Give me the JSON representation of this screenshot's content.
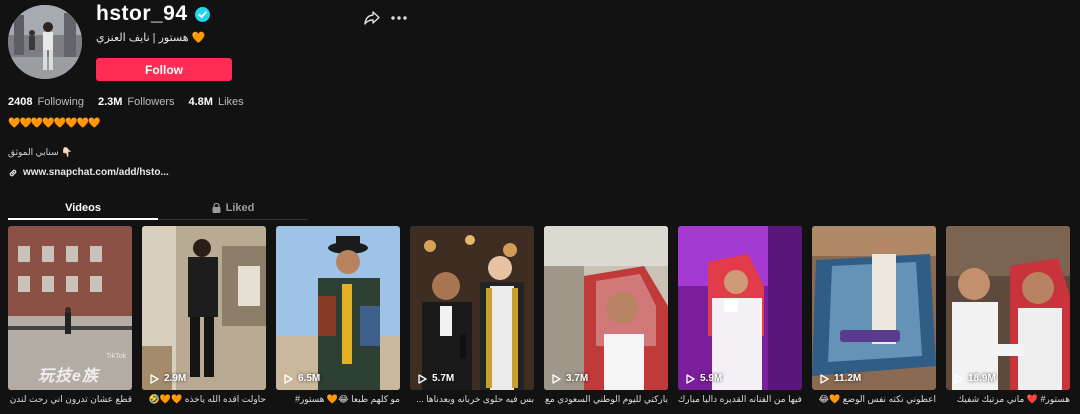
{
  "profile": {
    "username": "hstor_94",
    "nickname": "هستور | نايف العنزي 🧡",
    "follow_label": "Follow"
  },
  "stats": {
    "following_count": "2408",
    "following_label": "Following",
    "followers_count": "2.3M",
    "followers_label": "Followers",
    "likes_count": "4.8M",
    "likes_label": "Likes"
  },
  "bio": {
    "hearts": "🧡🧡🧡🧡🧡🧡🧡🧡",
    "line": "سنابي الموثق 👇🏻",
    "link": "www.snapchat.com/add/hsto..."
  },
  "tabs": {
    "videos": "Videos",
    "liked": "Liked"
  },
  "videos": [
    {
      "views": "",
      "caption": "قطع عشان تدرون اني رحت لندن"
    },
    {
      "views": "2.9M",
      "caption": "حاولت اقده الله ياخذه 🧡🧡🤣"
    },
    {
      "views": "6.5M",
      "caption": "مو كلهم طبعا 😂🧡 هستور#"
    },
    {
      "views": "5.7M",
      "caption": "بس فيه حلوى خربانه وبعدناها ..."
    },
    {
      "views": "3.7M",
      "caption": "باركتي لليوم الوطني السعودي مع..."
    },
    {
      "views": "5.9M",
      "caption": "فيها من الفنانه القديره داليا مبارك ..."
    },
    {
      "views": "11.2M",
      "caption": "اعطوني نكته نفس الوضع 🧡😂"
    },
    {
      "views": "18.9M",
      "caption": "هستور# ❤️ ماني مرتبك شفيك"
    }
  ],
  "overlays": {
    "watermark": "玩技e族",
    "tiktok_mark": "TikTok"
  },
  "icons": {
    "verified": "verified-badge-icon",
    "share": "share-icon",
    "more": "more-icon",
    "link": "link-icon",
    "lock": "lock-icon",
    "play": "play-icon"
  },
  "colors": {
    "background": "#121212",
    "follow_button": "#fe2c55",
    "verified": "#20d5ec"
  }
}
